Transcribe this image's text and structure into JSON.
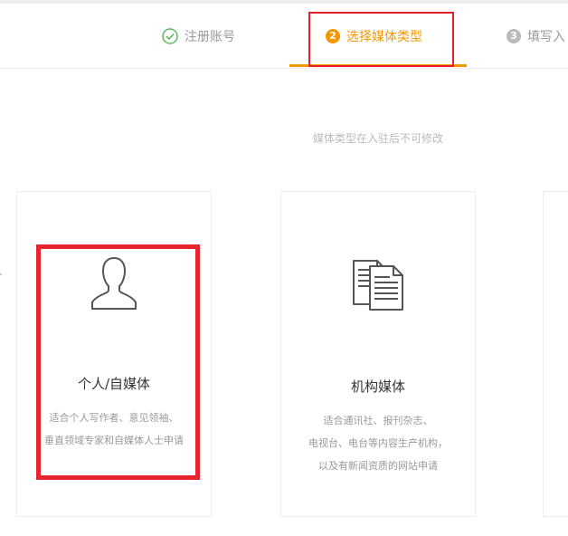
{
  "steps": [
    {
      "number": "",
      "label": "注册账号",
      "state": "done"
    },
    {
      "number": "2",
      "label": "选择媒体类型",
      "state": "active"
    },
    {
      "number": "3",
      "label": "填写入",
      "state": "pending"
    }
  ],
  "notice": "媒体类型在入驻后不可修改",
  "cards": {
    "personal": {
      "icon": "person-icon",
      "title": "个人/自媒体",
      "desc_lines": [
        "适合个人写作者、意见领袖、",
        "垂直领域专家和自媒体人士申请"
      ]
    },
    "org": {
      "icon": "documents-icon",
      "title": "机构媒体",
      "desc_lines": [
        "适合通讯社、报刊杂志、",
        "电视台、电台等内容生产机构，",
        "以及有新闻资质的网站申请"
      ]
    }
  },
  "colors": {
    "accent": "#f39800",
    "done": "#5cb85c",
    "annotation": "#e61e27"
  }
}
